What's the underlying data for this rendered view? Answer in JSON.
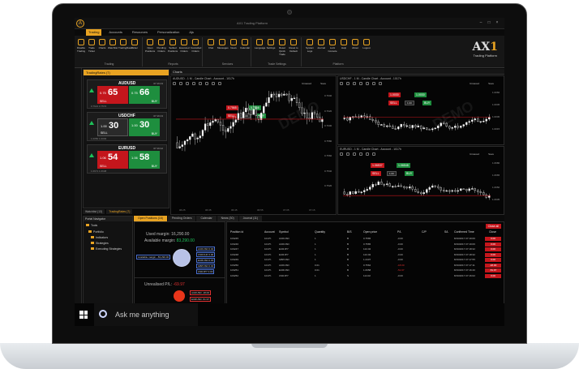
{
  "window": {
    "title": "AX1 Trading Platform",
    "minimize": "–",
    "maximize": "□",
    "close": "×"
  },
  "ribbon_tabs": [
    "Trading",
    "Accounts",
    "Resources",
    "Personalization",
    "Ajs"
  ],
  "ribbon": {
    "trading_buttons": [
      "Disable Trading",
      "Trade Ticket",
      "Charts",
      "Watchlist",
      "TradingRates",
      "Ticker"
    ],
    "trading_label": "Trading",
    "reports_buttons": [
      "Open Positions",
      "Pending Orders",
      "Settled Positions",
      "Executed Orders",
      "Cancelled Orders"
    ],
    "reports_label": "Reports",
    "services_buttons": [
      "Chat",
      "Messages",
      "News",
      "Calendar"
    ],
    "services_label": "Services",
    "settings_buttons": [
      "Language",
      "Settings",
      "Reset Quick Trade",
      "Reset to Default"
    ],
    "settings_label": "Trade Settings",
    "platform_buttons": [
      "System Logs",
      "Journal",
      "Lock Console",
      "Help",
      "About",
      "Logout"
    ],
    "platform_label": "Platform",
    "brand_logo": "AX",
    "brand_logo_sup": "1",
    "brand_sub": "Trading Platform"
  },
  "rates_panel": {
    "title": "TradingRates (7)",
    "tiles": [
      {
        "symbol": "AUDUSD",
        "time": "07:19:13",
        "sell_small": "0.75",
        "sell_big": "65",
        "sell_label": "SELL",
        "buy_small": "0.75",
        "buy_big": "66",
        "buy_label": "BUY",
        "foot": "0.7621 0.7572",
        "arrow": "up",
        "sell_color": "#c4161c",
        "buy_color": "#1e8e3e"
      },
      {
        "symbol": "USDCHF",
        "time": "07:19:13",
        "sell_small": "1.00",
        "sell_big": "30",
        "sell_label": "SELL",
        "buy_small": "1.00",
        "buy_big": "30",
        "buy_label": "BUY",
        "foot": "1.0050 1.0003",
        "arrow": "up",
        "sell_color": "#2a2a2a",
        "buy_color": "#1e8e3e"
      },
      {
        "symbol": "EURUSD",
        "time": "07:19:12",
        "sell_small": "1.06",
        "sell_big": "54",
        "sell_label": "SELL",
        "buy_small": "1.06",
        "buy_big": "58",
        "buy_label": "BUY",
        "foot": "1.0671 1.0638",
        "arrow": "up",
        "sell_color": "#c4161c",
        "buy_color": "#1e8e3e"
      }
    ],
    "tabs": [
      "Watchlist (13)",
      "TradingRates (7)"
    ]
  },
  "charts": {
    "header": "Charts",
    "left": {
      "title": "AUDUSD - 1 M - Candle Chart - Account - 1017h",
      "sell_price": "0.7565",
      "buy_price": "0.7566",
      "sell_label": "SELL",
      "buy_label": "BUY",
      "qty": "1.00",
      "y_labels": [
        "0.7640",
        "0.7620",
        "0.7600",
        "0.7580",
        "0.7560",
        "0.7540",
        "0.7520"
      ],
      "x_labels": [
        "06:25",
        "06:35",
        "06:45",
        "06:55",
        "07:05",
        "07:15"
      ],
      "unsaved": "Unsaved",
      "save": "Save"
    },
    "right_top": {
      "title": "USDCHF - 1 M - Candle Chart - Account - 1017h",
      "sell_price": "1.0030",
      "buy_price": "1.0030",
      "sell_label": "SELL",
      "buy_label": "BUY",
      "qty": "1.00",
      "y_labels": [
        "1.0060",
        "1.0045",
        "1.0030",
        "1.0015"
      ],
      "unsaved": "Unsaved",
      "save": "Save"
    },
    "right_bottom": {
      "title": "EURUSD - 1 M - Candle Chart - Account - 1017h",
      "sell_price": "1.06537",
      "buy_price": "1.06548",
      "sell_label": "SELL",
      "buy_label": "BUY",
      "qty": "1.00",
      "y_labels": [
        "1.0680",
        "1.0665",
        "1.0650",
        "1.0635"
      ],
      "unsaved": "Unsaved",
      "save": "Save"
    }
  },
  "account_panel": {
    "title": "Portal Navigator",
    "tree": [
      "Tools",
      "Portfolio",
      "Indicators",
      "Strategies",
      "Executing Strategies"
    ]
  },
  "bottom_tabs": [
    "Open Positions (16)",
    "Pending Orders",
    "Calendar",
    "News (30)",
    "Journal (11)"
  ],
  "open_positions": {
    "used_margin_label": "Used margin:",
    "used_margin": "16,290.00",
    "available_margin_label": "Available margin:",
    "available_margin": "83,290.00",
    "unrealised_label": "Unrealised P/L:",
    "unrealised": "-69.97",
    "label_boxes": [
      "Available margin - 83,290.00",
      "AUDUSD 0.00",
      "USDCHF 0.00",
      "EURUSD 0.00",
      "GBPUSD 0.00",
      "USDJPY 0.00",
      "AUDUSD -18.00",
      "EURUSD -51.97"
    ]
  },
  "positions_table": {
    "close_all": "Close all",
    "headers": [
      "Position id",
      "Account",
      "Symbol",
      "Quantity",
      "B/S",
      "Open price",
      "P/L",
      "C/P",
      "S/L",
      "Confirmed Time",
      "Close"
    ],
    "rows": [
      [
        "103245",
        "1017h",
        "AUDUSD",
        "1",
        "B",
        "0.7565",
        "-0.00",
        "",
        "",
        "8/19/2017 07:19:06",
        "0.00"
      ],
      [
        "103246",
        "1017h",
        "AUDUSD",
        "1",
        "B",
        "0.7565",
        "-0.00",
        "",
        "",
        "8/19/2017 07:19:06",
        "0.00"
      ],
      [
        "103247",
        "1017h",
        "EURJPY",
        "1",
        "B",
        "124.02",
        "-0.00",
        "",
        "",
        "8/19/2017 07:18:32",
        "0.00"
      ],
      [
        "103248",
        "1017h",
        "EURJPY",
        "1",
        "B",
        "124.02",
        "-0.00",
        "",
        "",
        "8/19/2017 07:18:32",
        "0.00"
      ],
      [
        "103249",
        "1017h",
        "GBPUSD",
        "1",
        "B",
        "1.2437",
        "-0.00",
        "",
        "",
        "8/19/2017 07:17:55",
        "0.00"
      ],
      [
        "103250",
        "1017h",
        "AUDUSD",
        "0.01",
        "S",
        "0.7562",
        "-18.00",
        "",
        "",
        "8/19/2017 07:17:11",
        "-18.00"
      ],
      [
        "103251",
        "1017h",
        "EURUSD",
        "0.01",
        "B",
        "1.0658",
        "-51.97",
        "",
        "",
        "8/19/2017 07:16:40",
        "-51.97"
      ],
      [
        "103252",
        "1017h",
        "USDJPY",
        "1",
        "S",
        "114.02",
        "-0.00",
        "",
        "",
        "8/19/2017 07:16:02",
        "0.00"
      ]
    ]
  },
  "watermark": "DEMO",
  "taskbar": {
    "search_placeholder": "Ask me anything"
  },
  "colors": {
    "accent": "#e8a322",
    "sell": "#c4161c",
    "buy": "#1e8e3e",
    "up": "#1ec25a",
    "down": "#e03131"
  }
}
